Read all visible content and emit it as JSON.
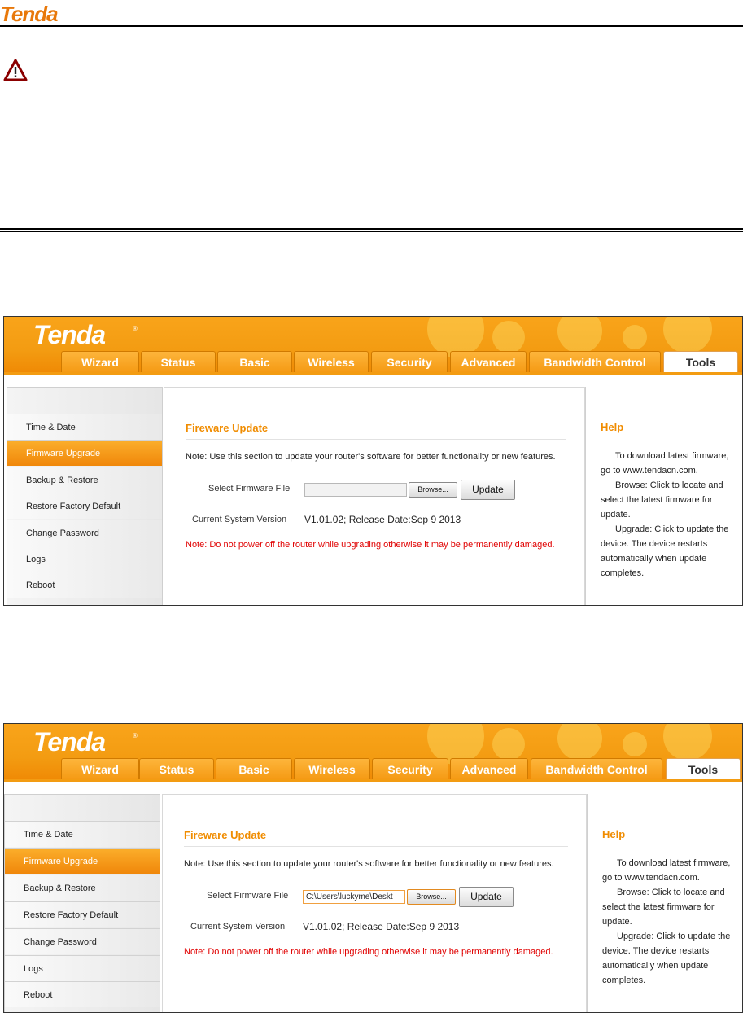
{
  "doc": {
    "brand": "Tenda",
    "warning_icon": "warning-triangle-icon"
  },
  "router": {
    "brand": "Tenda",
    "brand_mark": "®",
    "tabs": [
      "Wizard",
      "Status",
      "Basic",
      "Wireless",
      "Security",
      "Advanced",
      "Bandwidth Control",
      "Tools"
    ],
    "active_tab": "Tools",
    "sidebar": [
      "Time & Date",
      "Firmware Upgrade",
      "Backup & Restore",
      "Restore Factory Default",
      "Change Password",
      "Logs",
      "Reboot"
    ],
    "active_sidebar": "Firmware Upgrade",
    "content": {
      "title": "Fireware Update",
      "note": "Note: Use this section to update your router's software for better functionality or new features.",
      "file_label": "Select Firmware File",
      "browse_label": "Browse...",
      "update_label": "Update",
      "version_label": "Current System Version",
      "version_value": "V1.01.02; Release Date:Sep 9 2013",
      "warning": "Note: Do not power off the router while upgrading otherwise it may be permanently damaged."
    },
    "help": {
      "title": "Help",
      "p1": "To download latest firmware, go to www.tendacn.com.",
      "p2": "Browse: Click to locate and select the latest firmware for update.",
      "p3": "Upgrade: Click to update the device. The device restarts automatically when update completes."
    }
  },
  "screenshot1": {
    "file_value": ""
  },
  "screenshot2": {
    "file_value": "C:\\Users\\luckyme\\Deskt"
  },
  "colors": {
    "accent": "#f08c00",
    "banner": "#f39c12",
    "warning_text": "#e00000"
  }
}
